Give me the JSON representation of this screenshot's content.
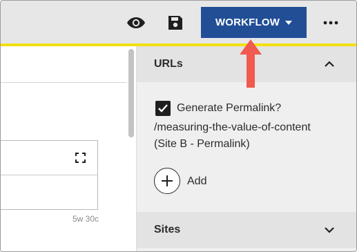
{
  "toolbar": {
    "workflow_label": "WORKFLOW",
    "icons": {
      "preview": "eye-icon",
      "save": "floppy-disk-icon",
      "more": "more-horizontal-icon"
    },
    "accent_color": "#f3df12",
    "workflow_color": "#224e96"
  },
  "content": {
    "word_count": "5w 30c",
    "expand_icon": "expand-icon"
  },
  "sidebar": {
    "urls": {
      "title": "URLs",
      "expanded": true,
      "generate_permalink_label": "Generate Permalink?",
      "generate_permalink_checked": true,
      "url_path": "/measuring-the-value-of-content",
      "url_site": "(Site B - Permalink)",
      "add_label": "Add"
    },
    "sites": {
      "title": "Sites",
      "expanded": false
    }
  },
  "annotation": {
    "arrow_color": "#f05a4f"
  }
}
